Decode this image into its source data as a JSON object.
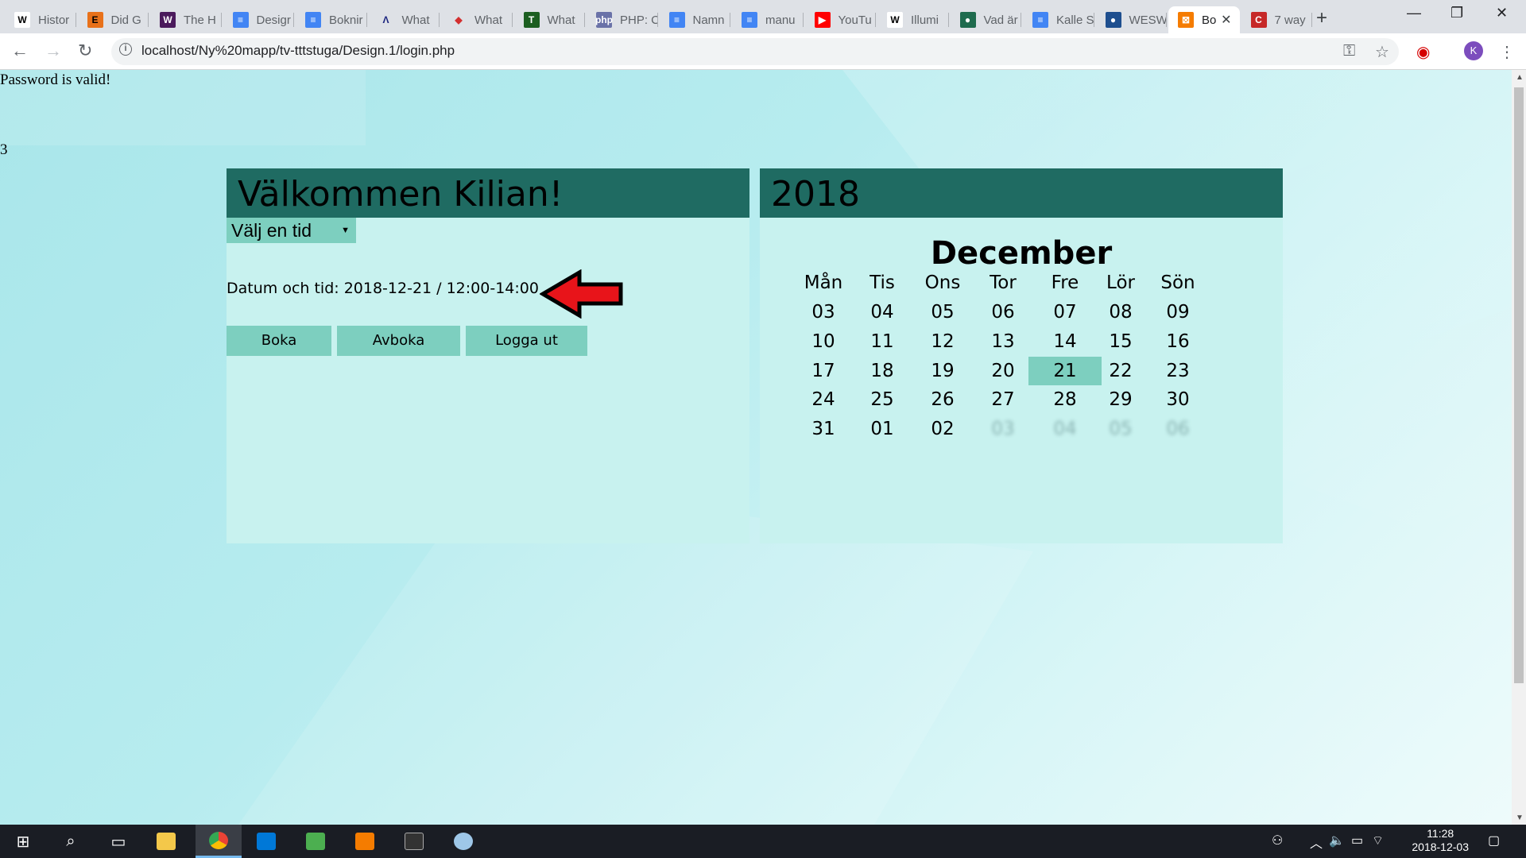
{
  "browser": {
    "tabs": [
      {
        "icon": "W",
        "title": "Histor",
        "color": "#ffffff",
        "fg": "#000"
      },
      {
        "icon": "E",
        "title": "Did G",
        "color": "#e8711a",
        "fg": "#000"
      },
      {
        "icon": "W",
        "title": "The H",
        "color": "#4b1a5c",
        "fg": "#fff"
      },
      {
        "icon": "≡",
        "title": "Desigr",
        "color": "#4285f4",
        "fg": "#fff"
      },
      {
        "icon": "≡",
        "title": "Boknir",
        "color": "#4285f4",
        "fg": "#fff"
      },
      {
        "icon": "Λ",
        "title": "What",
        "color": "#dee1e6",
        "fg": "#1a237e"
      },
      {
        "icon": "◆",
        "title": "What",
        "color": "#dee1e6",
        "fg": "#d32f2f"
      },
      {
        "icon": "T",
        "title": "What",
        "color": "#1b5e20",
        "fg": "#fff"
      },
      {
        "icon": "php",
        "title": "PHP: C",
        "color": "#6a72a8",
        "fg": "#fff"
      },
      {
        "icon": "≡",
        "title": "Namn",
        "color": "#4285f4",
        "fg": "#fff"
      },
      {
        "icon": "≡",
        "title": "manu",
        "color": "#4285f4",
        "fg": "#fff"
      },
      {
        "icon": "▶",
        "title": "YouTu",
        "color": "#ff0000",
        "fg": "#fff"
      },
      {
        "icon": "W",
        "title": "Illumi",
        "color": "#ffffff",
        "fg": "#000"
      },
      {
        "icon": "●",
        "title": "Vad är",
        "color": "#1f6b4e",
        "fg": "#fff"
      },
      {
        "icon": "≡",
        "title": "Kalle S",
        "color": "#4285f4",
        "fg": "#fff"
      },
      {
        "icon": "●",
        "title": "WESW",
        "color": "#1e4f8f",
        "fg": "#fff"
      },
      {
        "icon": "⊠",
        "title": "Bo",
        "color": "#f57c00",
        "fg": "#fff"
      },
      {
        "icon": "C",
        "title": "7 way",
        "color": "#c62828",
        "fg": "#fff"
      }
    ],
    "active_tab_index": 16,
    "url": "localhost/Ny%20mapp/tv-tttstuga/Design.1/login.php",
    "profile_initial": "K"
  },
  "page": {
    "status_message": "Password is valid!",
    "stray_text": "3",
    "welcome_title": "Välkommen Kilian!",
    "select_label": "Välj en tid",
    "datum_text": "Datum och tid: 2018-12-21 / 12:00-14:00",
    "buttons": {
      "book": "Boka",
      "cancel": "Avboka",
      "logout": "Logga ut"
    }
  },
  "calendar": {
    "year": "2018",
    "month": "December",
    "weekdays": [
      "Mån",
      "Tis",
      "Ons",
      "Tor",
      "Fre",
      "Lör",
      "Sön"
    ],
    "weeks": [
      [
        "03",
        "04",
        "05",
        "06",
        "07",
        "08",
        "09"
      ],
      [
        "10",
        "11",
        "12",
        "13",
        "14",
        "15",
        "16"
      ],
      [
        "17",
        "18",
        "19",
        "20",
        "21",
        "22",
        "23"
      ],
      [
        "24",
        "25",
        "26",
        "27",
        "28",
        "29",
        "30"
      ],
      [
        "31",
        "01",
        "02",
        "03",
        "04",
        "05",
        "06"
      ]
    ],
    "selected_day": "21",
    "faded_cells": [
      [
        4,
        3
      ],
      [
        4,
        4
      ],
      [
        4,
        5
      ],
      [
        4,
        6
      ]
    ],
    "selected_color": "#7dcfbf"
  },
  "colors": {
    "header": "#1f6b62",
    "panel": "#c8f2ef",
    "button": "#7dcfbf",
    "arrow": "#e8141a"
  },
  "taskbar": {
    "time": "11:28",
    "date": "2018-12-03"
  }
}
